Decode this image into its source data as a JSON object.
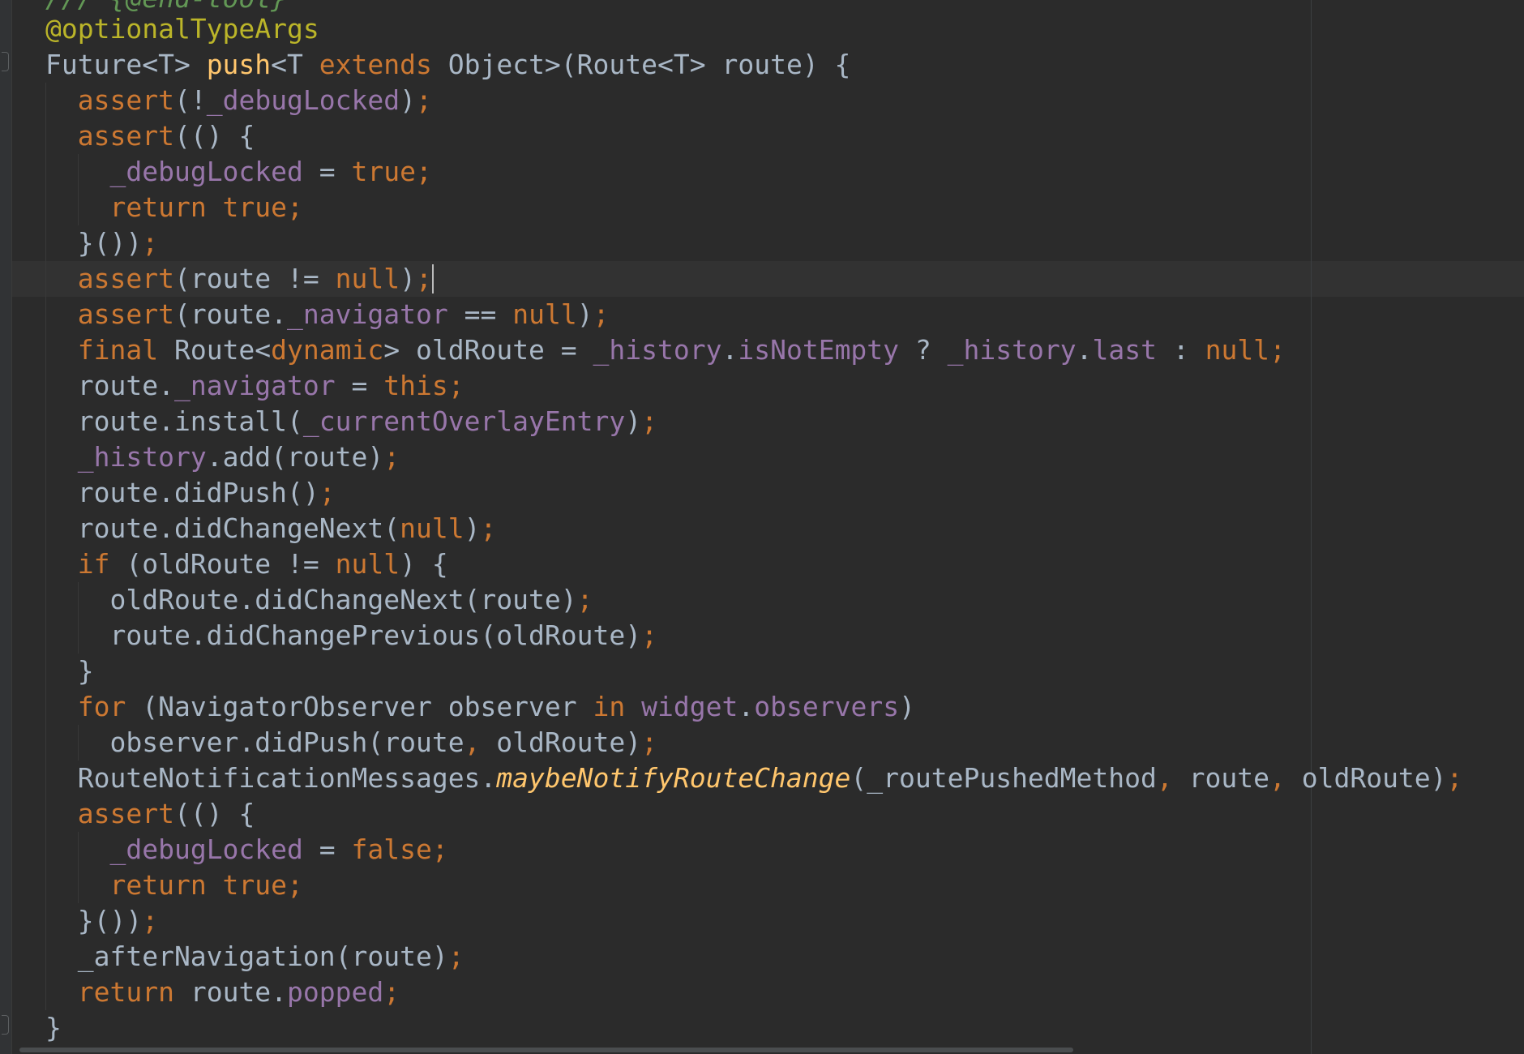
{
  "editor": {
    "language": "dart",
    "cursor_line": 8,
    "top_fragment": "/// {@end-tool}",
    "lines": [
      [
        [
          "@optionalTypeArgs",
          "ann"
        ]
      ],
      [
        [
          "Future<T> ",
          ""
        ],
        [
          "push",
          "fn"
        ],
        [
          "<T ",
          ""
        ],
        [
          "extends",
          "kw"
        ],
        [
          " Object>(Route<T> route) {",
          ""
        ]
      ],
      [
        [
          "  ",
          ""
        ],
        [
          "assert",
          "kw"
        ],
        [
          "(!",
          ""
        ],
        [
          "_debugLocked",
          "fld"
        ],
        [
          ")",
          ""
        ],
        [
          ";",
          "kw"
        ]
      ],
      [
        [
          "  ",
          ""
        ],
        [
          "assert",
          "kw"
        ],
        [
          "(() {",
          ""
        ]
      ],
      [
        [
          "    ",
          ""
        ],
        [
          "_debugLocked",
          "fld"
        ],
        [
          " = ",
          ""
        ],
        [
          "true",
          "kw"
        ],
        [
          ";",
          "kw"
        ]
      ],
      [
        [
          "    ",
          ""
        ],
        [
          "return true",
          "kw"
        ],
        [
          ";",
          "kw"
        ]
      ],
      [
        [
          "  }())",
          ""
        ],
        [
          ";",
          "kw"
        ]
      ],
      [
        [
          "  ",
          ""
        ],
        [
          "assert",
          "kw"
        ],
        [
          "(route != ",
          ""
        ],
        [
          "null",
          "kw"
        ],
        [
          ")",
          ""
        ],
        [
          ";",
          "kw"
        ]
      ],
      [
        [
          "  ",
          ""
        ],
        [
          "assert",
          "kw"
        ],
        [
          "(route.",
          ""
        ],
        [
          "_navigator",
          "fld"
        ],
        [
          " == ",
          ""
        ],
        [
          "null",
          "kw"
        ],
        [
          ")",
          ""
        ],
        [
          ";",
          "kw"
        ]
      ],
      [
        [
          "  ",
          ""
        ],
        [
          "final",
          "kw"
        ],
        [
          " Route<",
          ""
        ],
        [
          "dynamic",
          "kw"
        ],
        [
          "> oldRoute = ",
          ""
        ],
        [
          "_history",
          "fld"
        ],
        [
          ".",
          ""
        ],
        [
          "isNotEmpty",
          "fld"
        ],
        [
          " ? ",
          ""
        ],
        [
          "_history",
          "fld"
        ],
        [
          ".",
          ""
        ],
        [
          "last",
          "fld"
        ],
        [
          " : ",
          ""
        ],
        [
          "null",
          "kw"
        ],
        [
          ";",
          "kw"
        ]
      ],
      [
        [
          "  route.",
          ""
        ],
        [
          "_navigator",
          "fld"
        ],
        [
          " = ",
          ""
        ],
        [
          "this",
          "kw"
        ],
        [
          ";",
          "kw"
        ]
      ],
      [
        [
          "  route.install(",
          ""
        ],
        [
          "_currentOverlayEntry",
          "fld"
        ],
        [
          ")",
          ""
        ],
        [
          ";",
          "kw"
        ]
      ],
      [
        [
          "  ",
          ""
        ],
        [
          "_history",
          "fld"
        ],
        [
          ".add(route)",
          ""
        ],
        [
          ";",
          "kw"
        ]
      ],
      [
        [
          "  route.didPush()",
          ""
        ],
        [
          ";",
          "kw"
        ]
      ],
      [
        [
          "  route.didChangeNext(",
          ""
        ],
        [
          "null",
          "kw"
        ],
        [
          ")",
          ""
        ],
        [
          ";",
          "kw"
        ]
      ],
      [
        [
          "  ",
          ""
        ],
        [
          "if",
          "kw"
        ],
        [
          " (oldRoute != ",
          ""
        ],
        [
          "null",
          "kw"
        ],
        [
          ") {",
          ""
        ]
      ],
      [
        [
          "    oldRoute.didChangeNext(route)",
          ""
        ],
        [
          ";",
          "kw"
        ]
      ],
      [
        [
          "    route.didChangePrevious(oldRoute)",
          ""
        ],
        [
          ";",
          "kw"
        ]
      ],
      [
        [
          "  }",
          ""
        ]
      ],
      [
        [
          "  ",
          ""
        ],
        [
          "for",
          "kw"
        ],
        [
          " (NavigatorObserver observer ",
          ""
        ],
        [
          "in",
          "kw"
        ],
        [
          " ",
          ""
        ],
        [
          "widget",
          "fld"
        ],
        [
          ".",
          ""
        ],
        [
          "observers",
          "fld"
        ],
        [
          ")",
          ""
        ]
      ],
      [
        [
          "    observer.didPush(route",
          ""
        ],
        [
          ",",
          "kw"
        ],
        [
          " oldRoute)",
          ""
        ],
        [
          ";",
          "kw"
        ]
      ],
      [
        [
          "  RouteNotificationMessages.",
          ""
        ],
        [
          "maybeNotifyRouteChange",
          "ital"
        ],
        [
          "(_routePushedMethod",
          ""
        ],
        [
          ",",
          "kw"
        ],
        [
          " route",
          ""
        ],
        [
          ",",
          "kw"
        ],
        [
          " oldRoute)",
          ""
        ],
        [
          ";",
          "kw"
        ]
      ],
      [
        [
          "  ",
          ""
        ],
        [
          "assert",
          "kw"
        ],
        [
          "(() {",
          ""
        ]
      ],
      [
        [
          "    ",
          ""
        ],
        [
          "_debugLocked",
          "fld"
        ],
        [
          " = ",
          ""
        ],
        [
          "false",
          "kw"
        ],
        [
          ";",
          "kw"
        ]
      ],
      [
        [
          "    ",
          ""
        ],
        [
          "return true",
          "kw"
        ],
        [
          ";",
          "kw"
        ]
      ],
      [
        [
          "  }())",
          ""
        ],
        [
          ";",
          "kw"
        ]
      ],
      [
        [
          "  _afterNavigation(route)",
          ""
        ],
        [
          ";",
          "kw"
        ]
      ],
      [
        [
          "  ",
          ""
        ],
        [
          "return",
          "kw"
        ],
        [
          " route.",
          ""
        ],
        [
          "popped",
          "fld"
        ],
        [
          ";",
          "kw"
        ]
      ],
      [
        [
          "}",
          ""
        ]
      ]
    ]
  }
}
